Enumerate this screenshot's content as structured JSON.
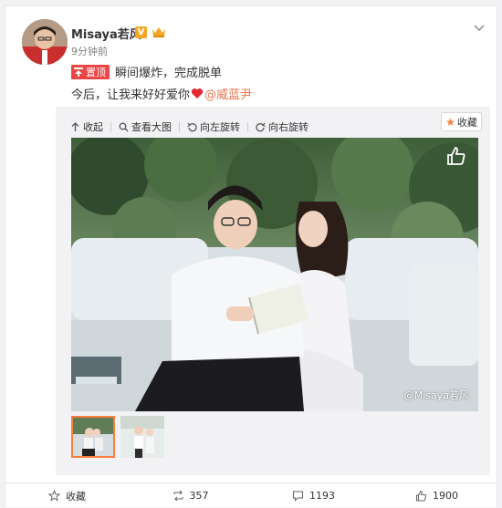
{
  "post": {
    "username": "Misaya若风",
    "verified_mark": "V",
    "timestamp": "9分钟前",
    "pin_label": "置顶",
    "line1_text": "瞬间爆炸，完成脱单",
    "line2_text": "今后，让我来好好爱你",
    "mention": "@威蓝尹"
  },
  "media_tools": {
    "collapse": "收起",
    "view_large": "查看大图",
    "rotate_left": "向左旋转",
    "rotate_right": "向右旋转",
    "favorite": "收藏"
  },
  "photo": {
    "watermark": "@Misaya若风"
  },
  "actions": {
    "favorite": "收藏",
    "repost_count": "357",
    "comment_count": "1193",
    "like_count": "1900"
  },
  "colors": {
    "accent": "#eb7350",
    "pin": "#eb4545",
    "star": "#fa7d3c",
    "vbadge": "#f5a623"
  }
}
